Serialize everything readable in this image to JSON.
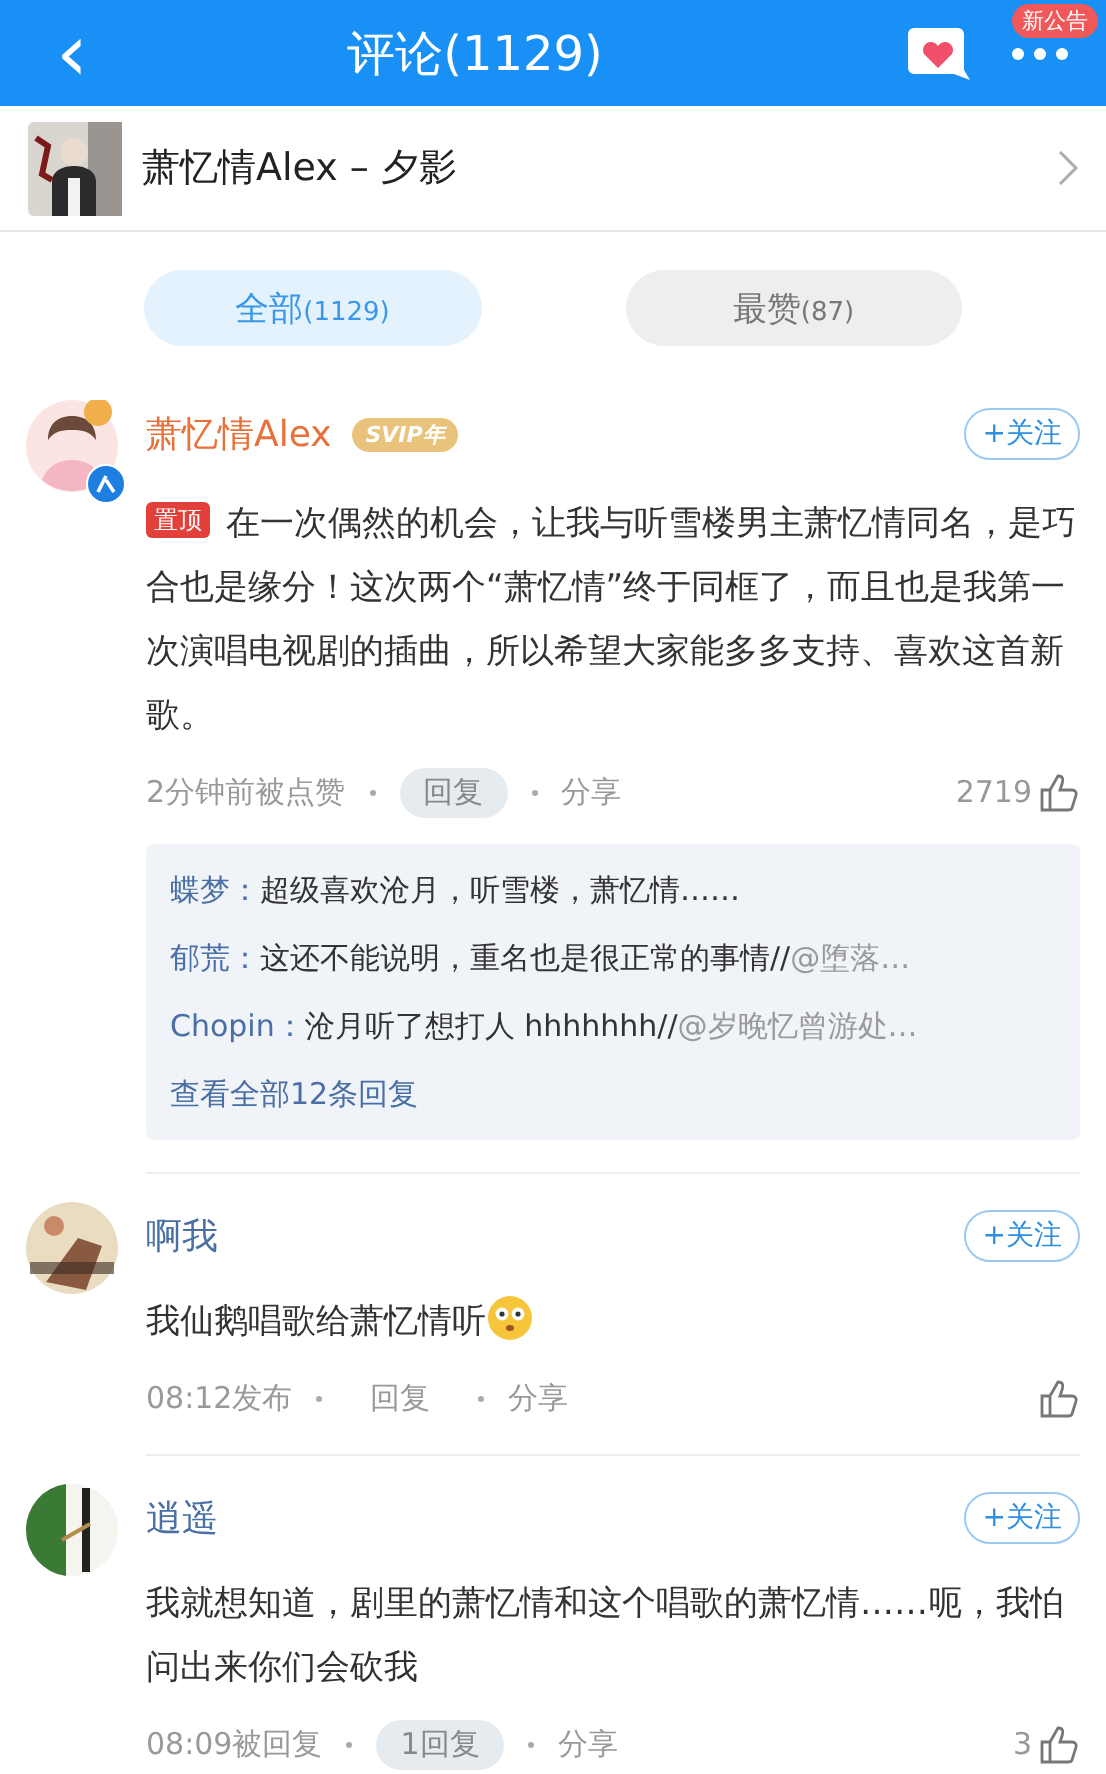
{
  "header": {
    "back": "‹",
    "title": "评论(1129)",
    "notice_badge": "新公告"
  },
  "song": {
    "title": "萧忆情Alex – 夕影"
  },
  "tabs": [
    {
      "label": "全部",
      "count": "(1129)",
      "selected": true
    },
    {
      "label": "最赞",
      "count": "(87)",
      "selected": false
    }
  ],
  "comments": [
    {
      "user": "萧忆情Alex",
      "author": true,
      "vip": "SVIP年",
      "verified": true,
      "follow": "+关注",
      "pinned": "置顶",
      "text": "在一次偶然的机会，让我与听雪楼男主萧忆情同名，是巧合也是缘分！这次两个“萧忆情”终于同框了，而且也是我第一次演唱电视剧的插曲，所以希望大家能多多支持、喜欢这首新歌。",
      "emoji": false,
      "time": "2分钟前被点赞",
      "reply": "回复",
      "reply_pill": true,
      "share": "分享",
      "likes": "2719",
      "replies": [
        {
          "name": "蝶梦：",
          "text": "超级喜欢沧月，听雪楼，萧忆情……"
        },
        {
          "name": "郁荒：",
          "text": "这还不能说明，重名也是很正常的事情//",
          "quote": "@堕落…"
        },
        {
          "name": "Chopin：",
          "text": "沧月听了想打人 hhhhhhh//",
          "quote": "@岁晚忆曾游处…"
        }
      ],
      "more": "查看全部12条回复"
    },
    {
      "user": "啊我",
      "author": false,
      "verified": false,
      "follow": "+关注",
      "text": "我仙鹅唱歌给萧忆情听",
      "emoji": true,
      "time": "08:12发布",
      "reply": "回复",
      "reply_pill": false,
      "share": "分享"
    },
    {
      "user": "逍遥",
      "author": false,
      "verified": false,
      "follow": "+关注",
      "text": "我就想知道，剧里的萧忆情和这个唱歌的萧忆情……呃，我怕问出来你们会砍我",
      "emoji": false,
      "time": "08:09被回复",
      "reply": "1回复",
      "reply_pill": true,
      "share": "分享",
      "likes": "3"
    }
  ]
}
